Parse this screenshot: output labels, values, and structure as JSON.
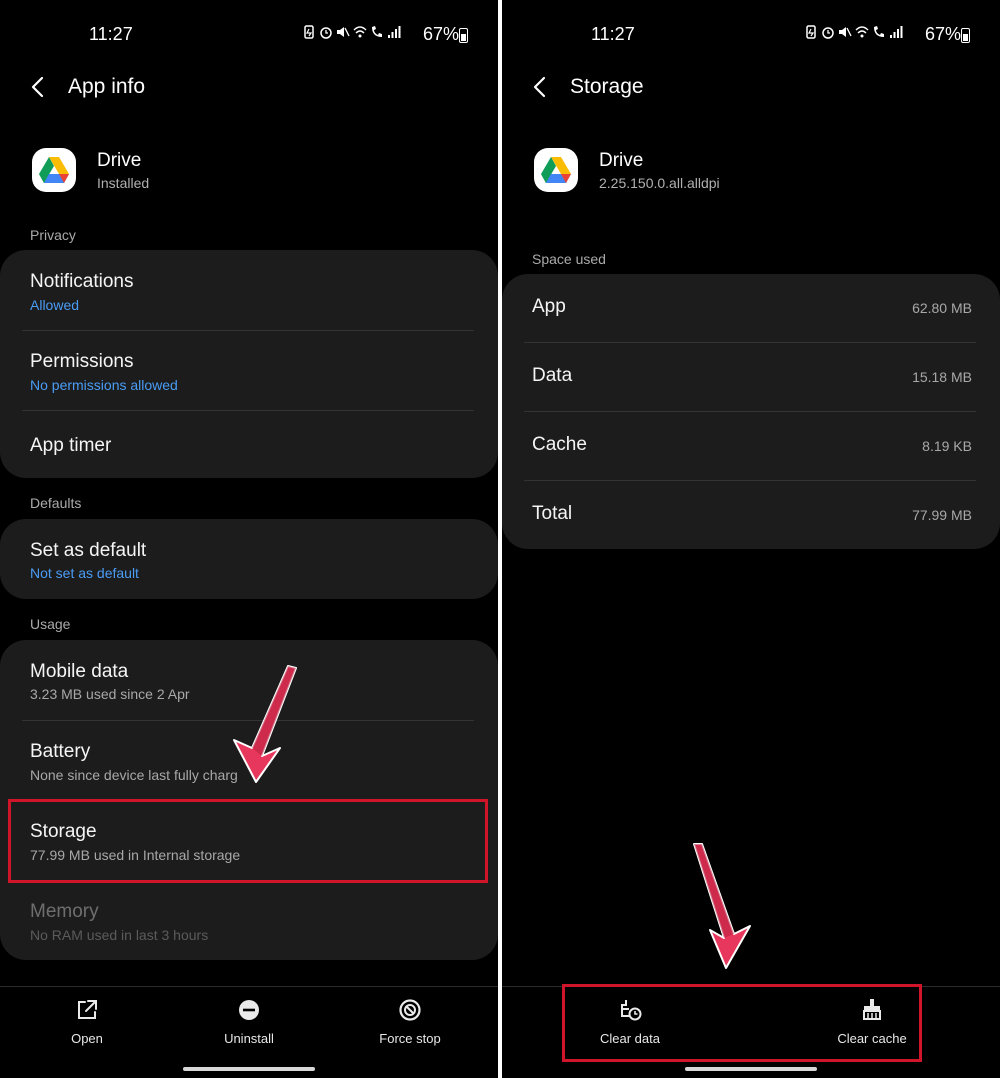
{
  "accent_red": "#d0152a",
  "accent_blue": "#4a9cf5",
  "left": {
    "status": {
      "time": "11:27",
      "battery": "67%"
    },
    "header": {
      "title": "App info"
    },
    "app": {
      "name": "Drive",
      "subtitle": "Installed"
    },
    "sections": {
      "privacy": "Privacy",
      "defaults": "Defaults",
      "usage": "Usage"
    },
    "privacy_items": [
      {
        "title": "Notifications",
        "sub": "Allowed"
      },
      {
        "title": "Permissions",
        "sub": "No permissions allowed"
      },
      {
        "title": "App timer"
      }
    ],
    "defaults_items": [
      {
        "title": "Set as default",
        "sub": "Not set as default"
      }
    ],
    "usage_items": [
      {
        "title": "Mobile data",
        "sub": "3.23 MB used since 2 Apr"
      },
      {
        "title": "Battery",
        "sub": "None since device last fully charg"
      },
      {
        "title": "Storage",
        "sub": "77.99 MB used in Internal storage"
      },
      {
        "title": "Memory",
        "sub": "No RAM used in last 3 hours"
      }
    ],
    "nav": {
      "open": "Open",
      "uninstall": "Uninstall",
      "force_stop": "Force stop"
    }
  },
  "right": {
    "status": {
      "time": "11:27",
      "battery": "67%"
    },
    "header": {
      "title": "Storage"
    },
    "app": {
      "name": "Drive",
      "subtitle": "2.25.150.0.all.alldpi"
    },
    "section": "Space used",
    "items": [
      {
        "label": "App",
        "value": "62.80 MB"
      },
      {
        "label": "Data",
        "value": "15.18 MB"
      },
      {
        "label": "Cache",
        "value": "8.19 KB"
      },
      {
        "label": "Total",
        "value": "77.99 MB"
      }
    ],
    "nav": {
      "clear_data": "Clear data",
      "clear_cache": "Clear cache"
    }
  }
}
